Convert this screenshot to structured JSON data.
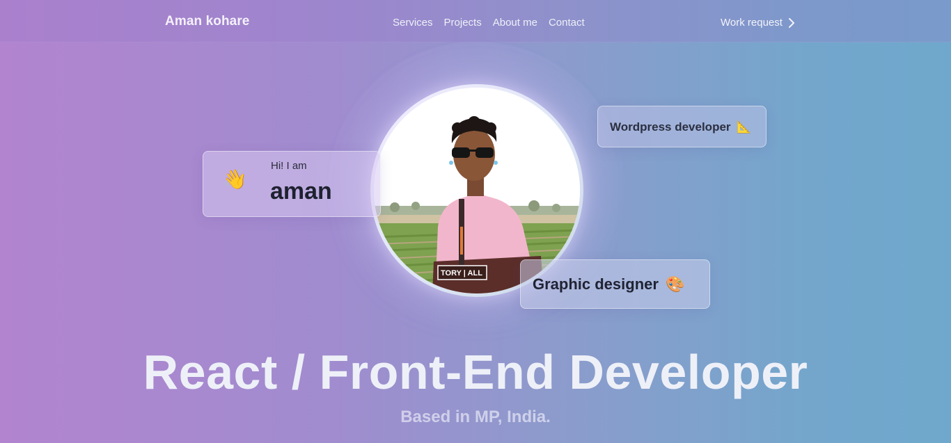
{
  "nav": {
    "brand": "Aman kohare",
    "links": [
      {
        "label": "Services"
      },
      {
        "label": "Projects"
      },
      {
        "label": "About me"
      },
      {
        "label": "Contact"
      }
    ],
    "cta": {
      "label": "Work request",
      "icon": "chevron-right-icon"
    }
  },
  "hero": {
    "greeting": {
      "icon": "👋",
      "small": "Hi! I am",
      "name": "aman"
    },
    "badges": {
      "wordpress": {
        "label": "Wordpress developer",
        "icon": "📐"
      },
      "graphic": {
        "label": "Graphic designer",
        "icon": "🎨"
      }
    },
    "title": "React / Front-End Developer",
    "subtitle": "Based in MP, India."
  },
  "colors": {
    "gradient_start": "#b284cf",
    "gradient_end": "#6fa8cc",
    "text_light": "#eef0f8",
    "text_dark": "#1f2430"
  }
}
